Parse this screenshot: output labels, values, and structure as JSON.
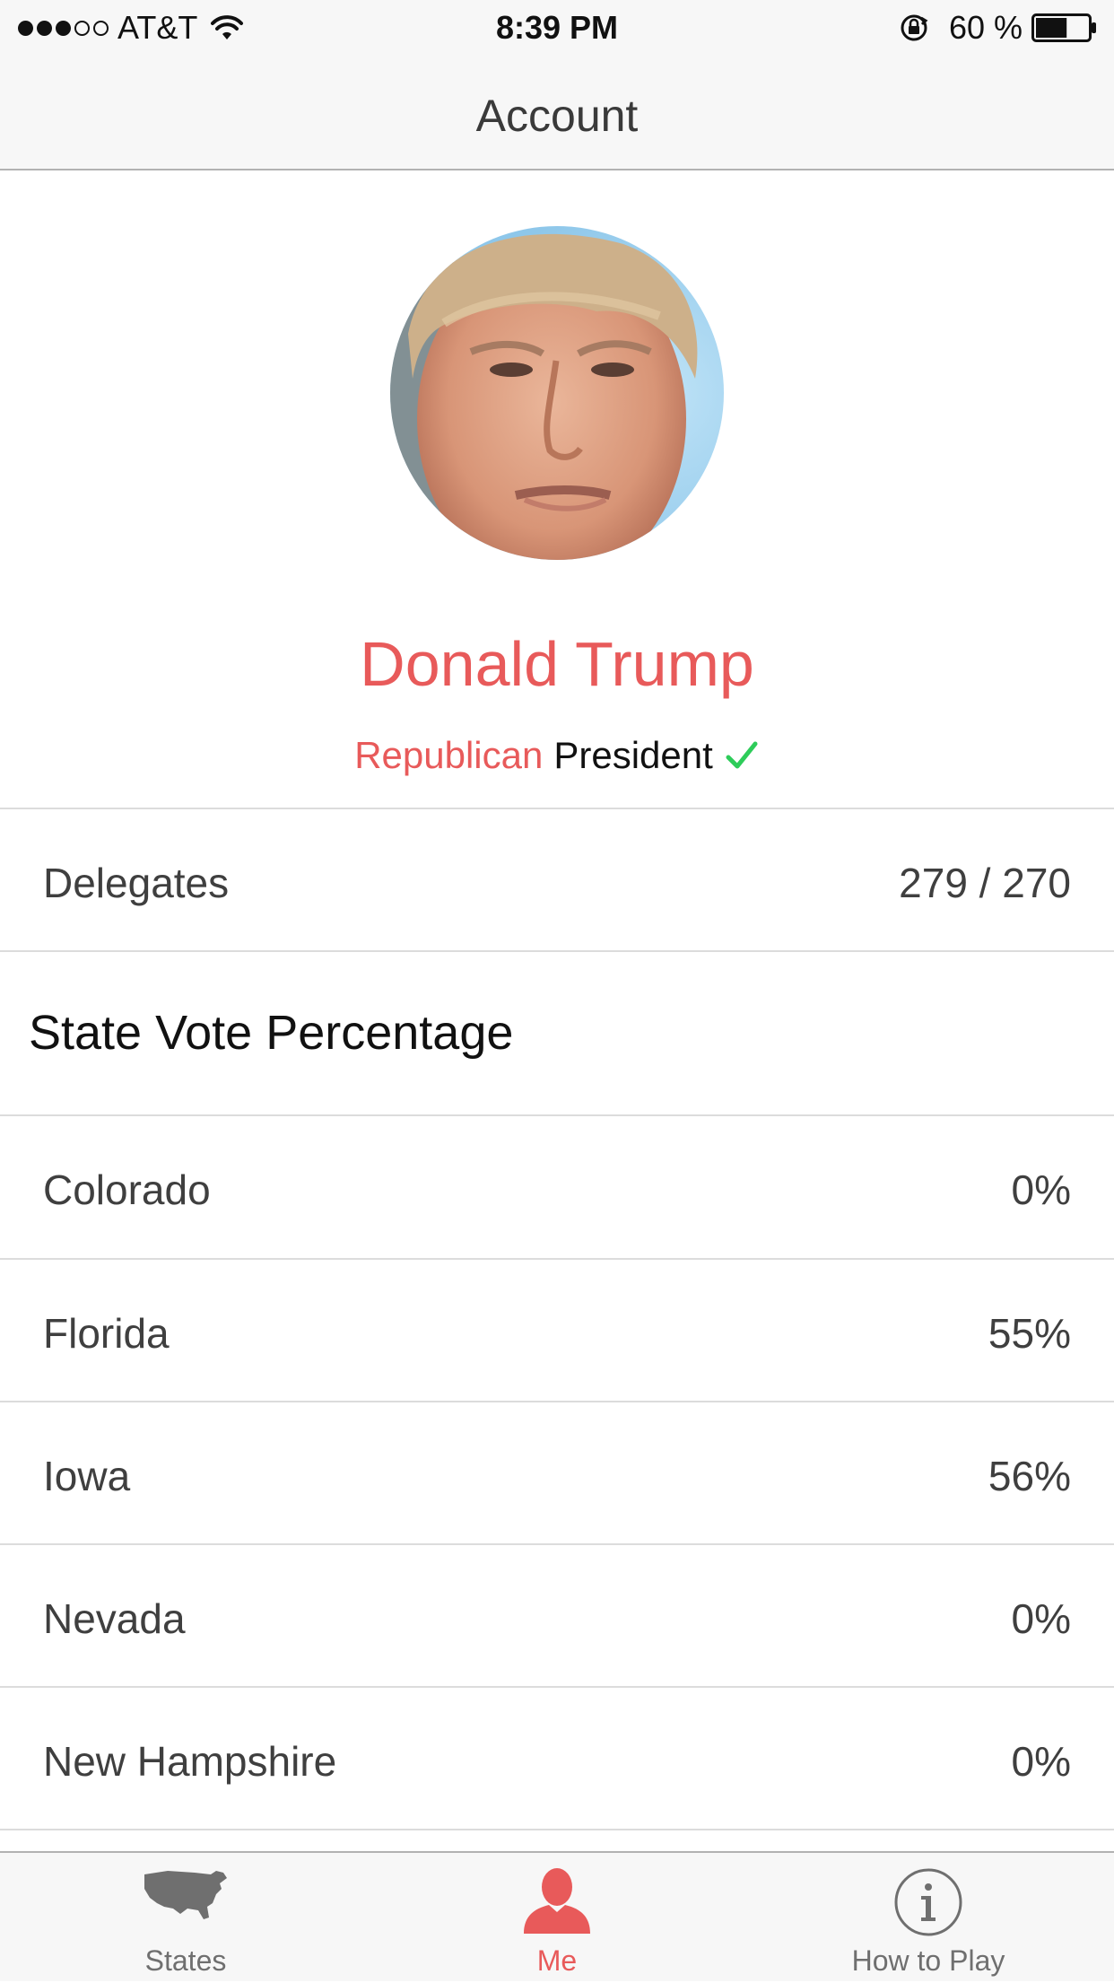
{
  "status_bar": {
    "carrier": "AT&T",
    "time": "8:39 PM",
    "battery_percent": "60 %",
    "signal_bars_filled": 3,
    "signal_bars_total": 5,
    "battery_level": 0.6
  },
  "nav": {
    "title": "Account"
  },
  "profile": {
    "name": "Donald Trump",
    "party": "Republican",
    "office": "President"
  },
  "delegates": {
    "label": "Delegates",
    "value": "279 / 270"
  },
  "section": {
    "title": "State Vote Percentage"
  },
  "states": [
    {
      "name": "Colorado",
      "percent": "0%"
    },
    {
      "name": "Florida",
      "percent": "55%"
    },
    {
      "name": "Iowa",
      "percent": "56%"
    },
    {
      "name": "Nevada",
      "percent": "0%"
    },
    {
      "name": "New Hampshire",
      "percent": "0%"
    }
  ],
  "tabs": [
    {
      "label": "States",
      "icon": "us-map-icon",
      "active": false
    },
    {
      "label": "Me",
      "icon": "person-icon",
      "active": true
    },
    {
      "label": "How to Play",
      "icon": "info-icon",
      "active": false
    }
  ],
  "colors": {
    "accent": "#e85a5a",
    "check": "#2ecc5a",
    "inactive_tab": "#6f6f6f",
    "text": "#3f3f3f"
  }
}
